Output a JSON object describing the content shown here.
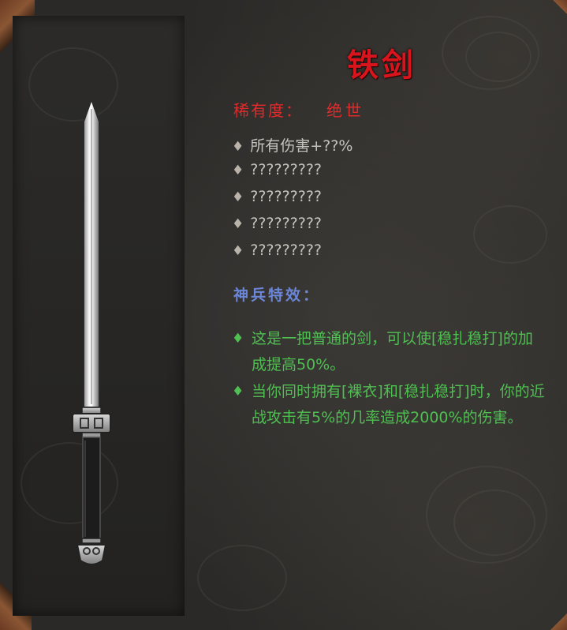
{
  "item": {
    "name": "铁剑",
    "rarity_label": "稀有度：",
    "rarity_value": "绝世"
  },
  "stats": [
    {
      "bullet": "♦",
      "text": "所有伤害+??%"
    },
    {
      "bullet": "♦",
      "text": "?????????"
    },
    {
      "bullet": "♦",
      "text": "?????????"
    },
    {
      "bullet": "♦",
      "text": "?????????"
    },
    {
      "bullet": "♦",
      "text": "?????????"
    }
  ],
  "special": {
    "title": "神兵特效：",
    "effects": [
      {
        "bullet": "♦",
        "text": "这是一把普通的剑，可以使[稳扎稳打]的加成提高50%。"
      },
      {
        "bullet": "♦",
        "text": "当你同时拥有[裸衣]和[稳扎稳打]时，你的近战攻击有5%的几率造成2000%的伤害。"
      }
    ]
  },
  "colors": {
    "title": "#d8141c",
    "rarity": "#e12a2a",
    "stats": "#c6c2bc",
    "special_title": "#6b86d6",
    "effects": "#4fbf52"
  },
  "icons": {
    "item_image": "iron-sword-icon",
    "bullet": "diamond-bullet-icon"
  }
}
